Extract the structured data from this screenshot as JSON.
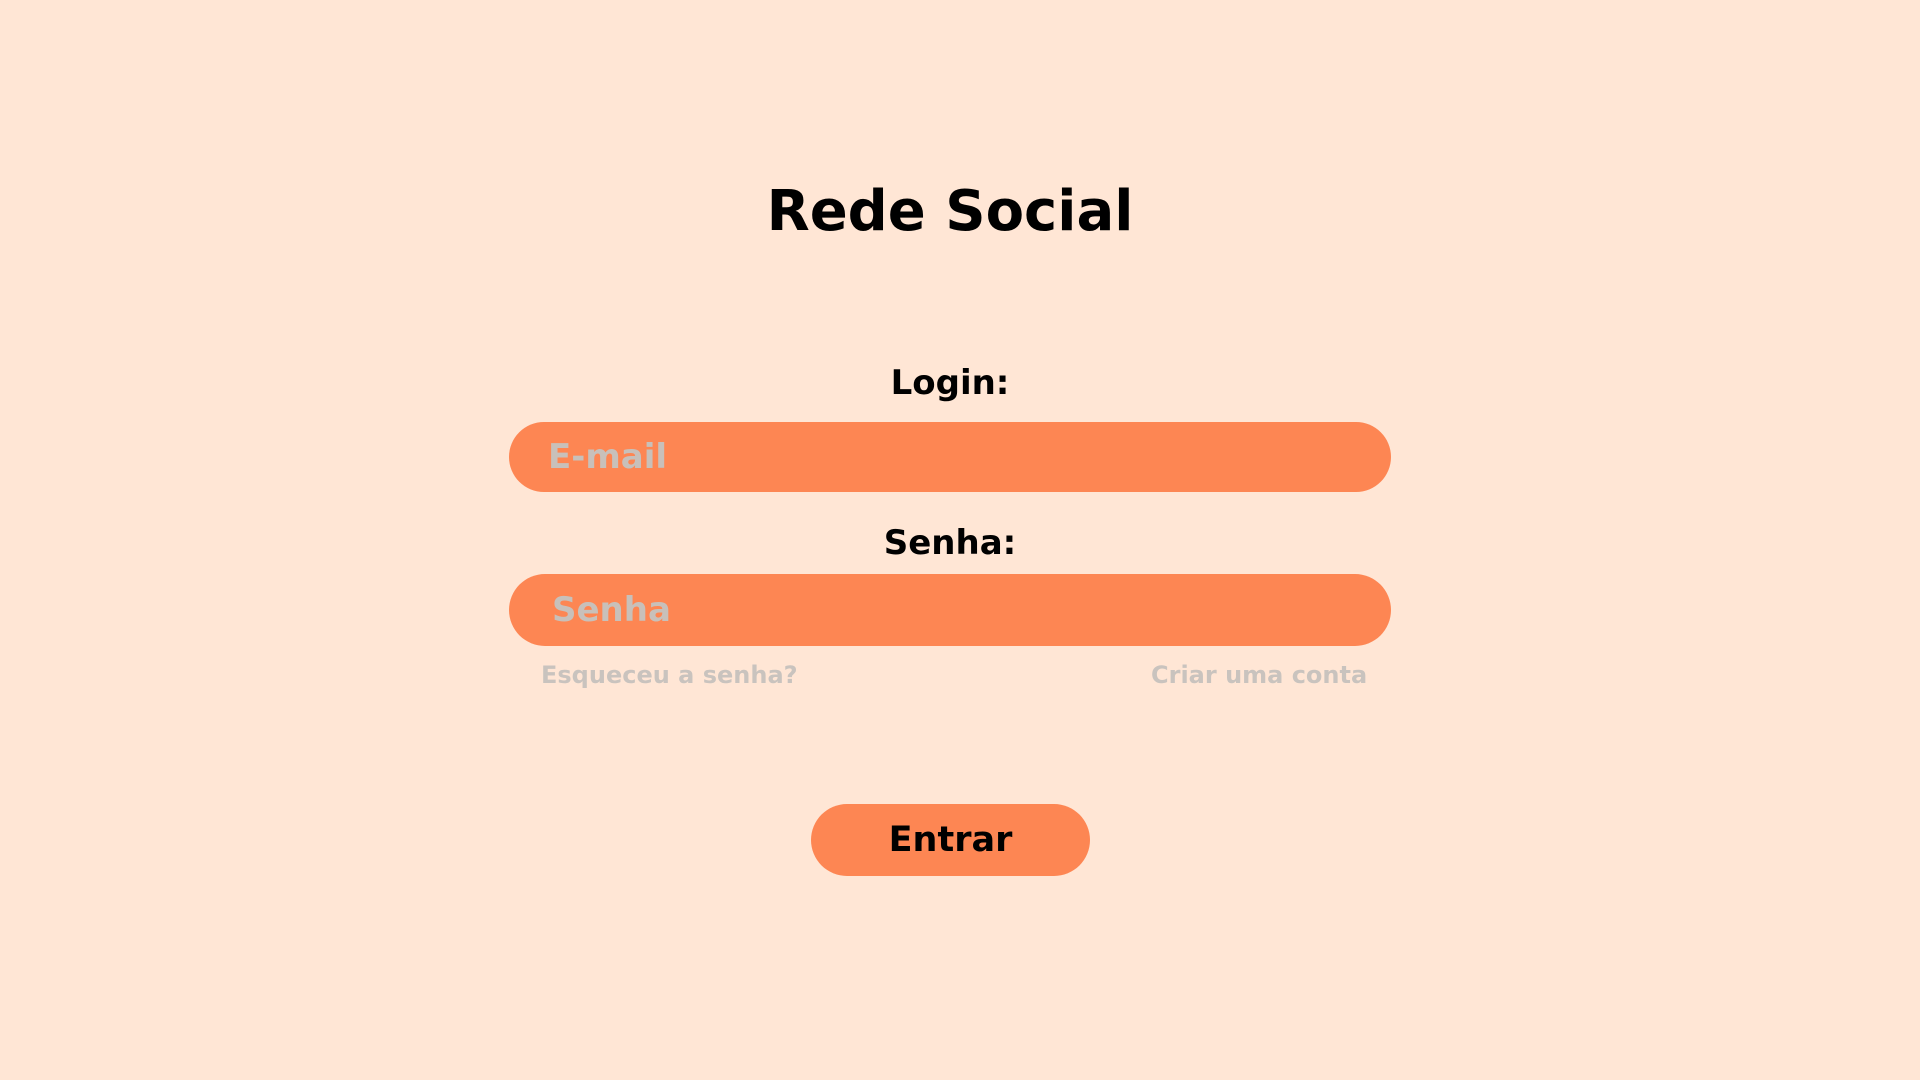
{
  "app": {
    "title": "Rede Social"
  },
  "login_form": {
    "login_label": "Login:",
    "email_placeholder": "E-mail",
    "email_value": "",
    "password_label": "Senha:",
    "password_placeholder": "Senha",
    "password_value": "",
    "forgot_password_link": "Esqueceu a senha?",
    "create_account_link": "Criar uma conta",
    "submit_label": "Entrar"
  },
  "colors": {
    "background": "#FFE6D5",
    "accent": "#FD8653",
    "placeholder_text": "#C8C0BA",
    "link_text": "#C9C3BE",
    "text": "#000000"
  }
}
